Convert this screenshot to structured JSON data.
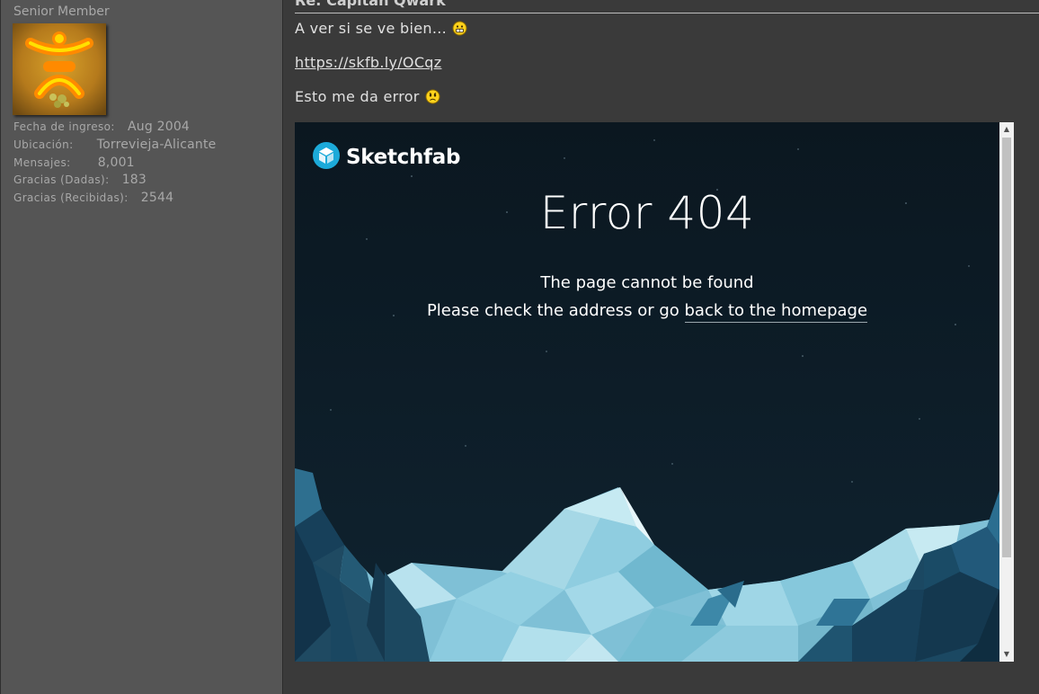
{
  "user": {
    "title": "Senior Member",
    "info": [
      {
        "label": "Fecha de ingreso:",
        "value": "Aug 2004"
      },
      {
        "label": "Ubicación:",
        "value": "Torrevieja-Alicante"
      },
      {
        "label": "Mensajes:",
        "value": "8,001"
      },
      {
        "label": "Gracias (Dadas):",
        "value": "183"
      },
      {
        "label": "Gracias (Recibidas):",
        "value": "2544"
      }
    ]
  },
  "post": {
    "title": "Re: Capitan Qwark",
    "line1": "A ver si se ve bien...",
    "link": "https://skfb.ly/OCqz",
    "line3": "Esto me da error",
    "smiley1": "grin-smiley-icon",
    "smiley2": "worried-smiley-icon"
  },
  "embed": {
    "brand": "Sketchfab",
    "error_title": "Error 404",
    "message1": "The page cannot be found",
    "message2_prefix": "Please check the address or go ",
    "message2_link": "back to the homepage"
  },
  "colors": {
    "sidebar_bg": "#555555",
    "post_bg": "#3a3a3a",
    "embed_bg": "#0d1c27",
    "sketchfab_blue": "#1caad9"
  }
}
